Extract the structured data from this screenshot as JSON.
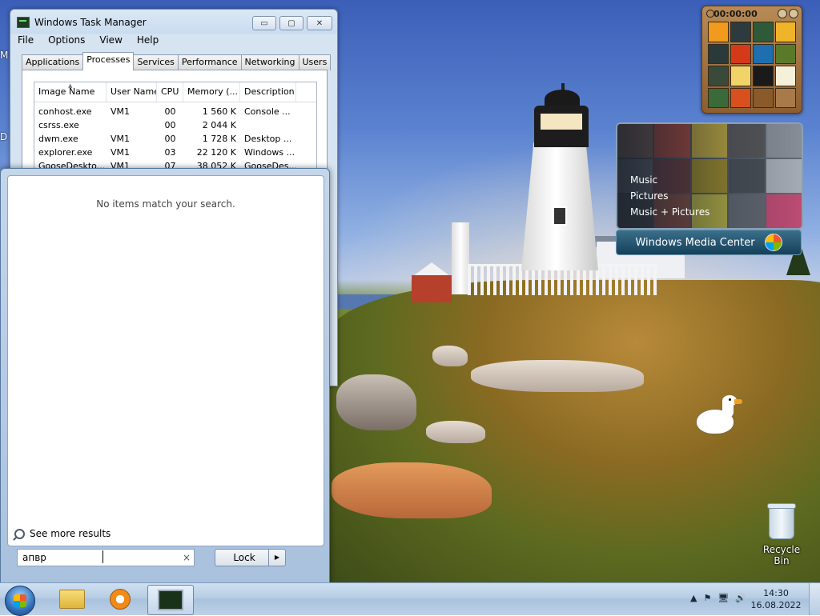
{
  "task_manager": {
    "title": "Windows Task Manager",
    "controls": {
      "minimize": "▭",
      "maximize": "▢",
      "close": "✕"
    },
    "menu": [
      "File",
      "Options",
      "View",
      "Help"
    ],
    "tabs": [
      "Applications",
      "Processes",
      "Services",
      "Performance",
      "Networking",
      "Users"
    ],
    "active_tab": "Processes",
    "columns": [
      "Image Name",
      "User Name",
      "CPU",
      "Memory (...",
      "Description"
    ],
    "rows": [
      [
        "conhost.exe",
        "VM1",
        "00",
        "1 560 K",
        "Console ..."
      ],
      [
        "csrss.exe",
        "",
        "00",
        "2 044 K",
        ""
      ],
      [
        "dwm.exe",
        "VM1",
        "00",
        "1 728 K",
        "Desktop ..."
      ],
      [
        "explorer.exe",
        "VM1",
        "03",
        "22 120 K",
        "Windows ..."
      ],
      [
        "GooseDeskto...",
        "VM1",
        "07",
        "38 052 K",
        "GooseDes..."
      ]
    ]
  },
  "start_menu": {
    "empty_message": "No items match your search.",
    "see_more": "See more results",
    "search_value": "апвр",
    "clear_glyph": "×",
    "lock_label": "Lock",
    "arrow_glyph": "▶"
  },
  "puzzle_gadget": {
    "timer": "00:00:00",
    "colors": [
      "#f29a1e",
      "#2d3b3e",
      "#2f5a3a",
      "#f0b42a",
      "#2a3a3a",
      "#d43a1a",
      "#1e6fb0",
      "#5a7a2a",
      "#3a4a3a",
      "#f2d36a",
      "#1a1a1a",
      "#f5f0da",
      "#3a6a3a",
      "#d8501e",
      "#8a5a2a",
      "#a87a4a"
    ]
  },
  "media_center": {
    "items": [
      "Music",
      "Pictures",
      "Music + Pictures"
    ],
    "brand": "Windows Media Center",
    "tile_colors": [
      "#8a6a5a",
      "#c94a3a",
      "#e0c43a",
      "#5a5a5a",
      "#9aa0a8",
      "#6a7480",
      "#7a3a3a",
      "#b8a020",
      "#4a5058",
      "#c0c8d0",
      "#3e4650",
      "#a05040",
      "#d8d040",
      "#6a7078",
      "#e04a7a"
    ]
  },
  "desktop": {
    "recycle_bin": "Recycle Bin",
    "edge_letters": [
      "M",
      "D"
    ]
  },
  "taskbar": {
    "time": "14:30",
    "date": "16.08.2022",
    "tray_icons": [
      "▲",
      "⚑",
      "🖥",
      "🔊"
    ]
  }
}
